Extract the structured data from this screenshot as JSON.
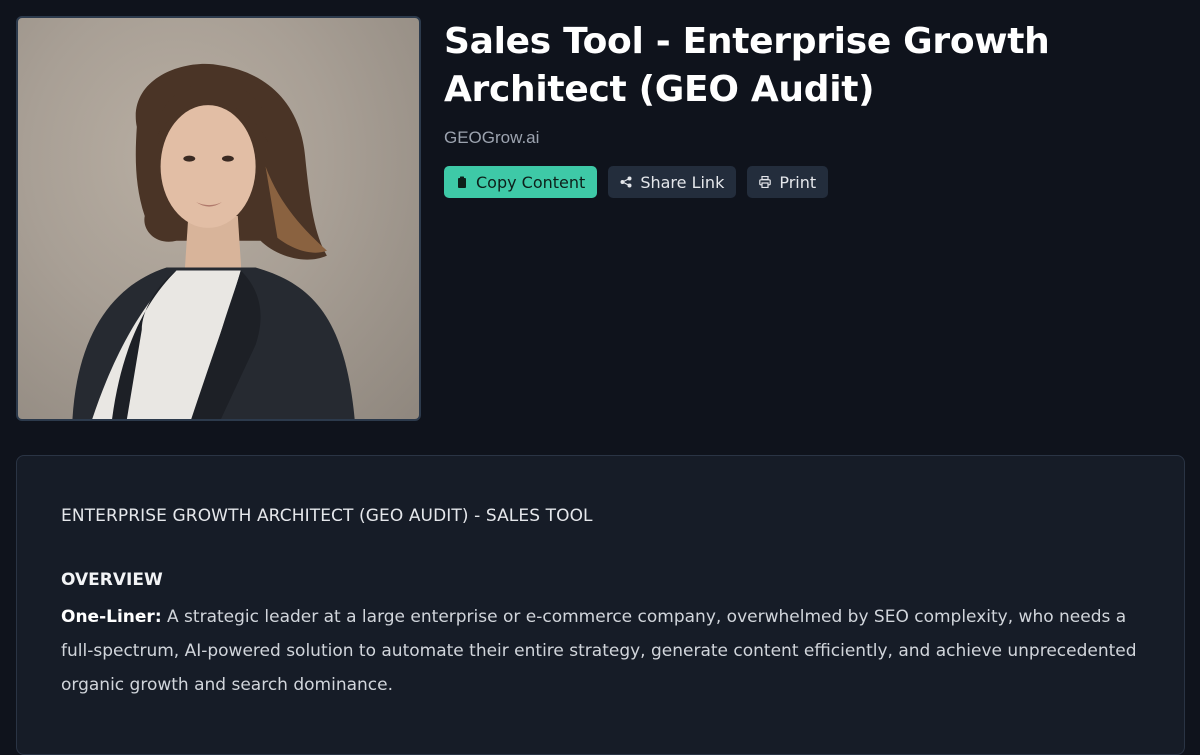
{
  "header": {
    "title": "Sales Tool - Enterprise Growth Architect (GEO Audit)",
    "brand": "GEOGrow.ai"
  },
  "actions": {
    "copy_label": "Copy Content",
    "share_label": "Share Link",
    "print_label": "Print"
  },
  "colors": {
    "primary_button": "#3ec9a7",
    "secondary_button": "#232d3c",
    "background": "#0f131c",
    "card": "#161c27"
  },
  "icons": {
    "copy": "clipboard-icon",
    "share": "share-icon",
    "print": "printer-icon"
  },
  "content": {
    "doc_heading": "ENTERPRISE GROWTH ARCHITECT (GEO AUDIT) - SALES TOOL",
    "overview_title": "OVERVIEW",
    "one_liner_label": "One-Liner:",
    "one_liner_text": " A strategic leader at a large enterprise or e-commerce company, overwhelmed by SEO complexity, who needs a full-spectrum, AI-powered solution to automate their entire strategy, generate content efficiently, and achieve unprecedented organic growth and search dominance."
  }
}
